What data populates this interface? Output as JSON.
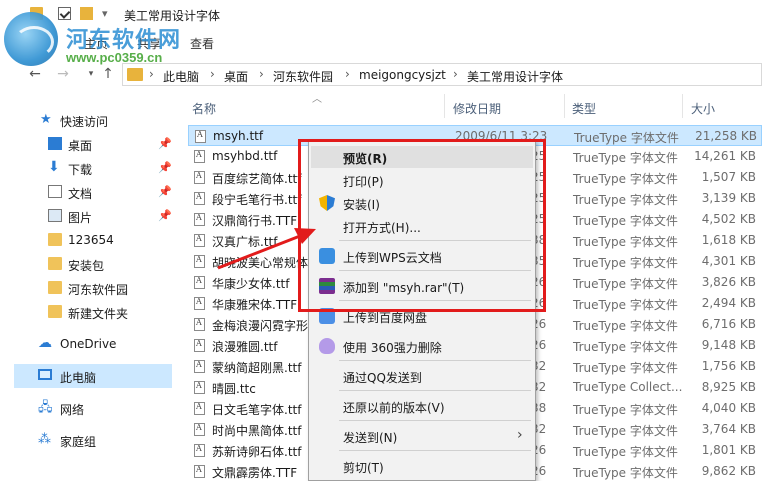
{
  "window": {
    "title": "美工常用设计字体"
  },
  "watermark": {
    "name": "河东软件网",
    "url": "www.pc0359.cn"
  },
  "ribbon": {
    "tabs": [
      "主页",
      "共享",
      "查看"
    ]
  },
  "address": {
    "crumbs": [
      "此电脑",
      "桌面",
      "河东软件园",
      "meigongcysjzt",
      "美工常用设计字体"
    ]
  },
  "navpane": {
    "items": [
      {
        "label": "快速访问",
        "icon": "star-icon",
        "pinned": false
      },
      {
        "label": "桌面",
        "icon": "desktop-icon",
        "pinned": true
      },
      {
        "label": "下载",
        "icon": "download-icon",
        "pinned": true
      },
      {
        "label": "文档",
        "icon": "document-icon",
        "pinned": true
      },
      {
        "label": "图片",
        "icon": "pictures-icon",
        "pinned": true
      },
      {
        "label": "123654",
        "icon": "folder-icon",
        "pinned": false
      },
      {
        "label": "安装包",
        "icon": "folder-icon",
        "pinned": false
      },
      {
        "label": "河东软件园",
        "icon": "folder-icon",
        "pinned": false
      },
      {
        "label": "新建文件夹",
        "icon": "folder-icon",
        "pinned": false
      },
      {
        "label": "OneDrive",
        "icon": "cloud-icon",
        "pinned": false
      },
      {
        "label": "此电脑",
        "icon": "pc-icon",
        "pinned": false
      },
      {
        "label": "网络",
        "icon": "network-icon",
        "pinned": false
      },
      {
        "label": "家庭组",
        "icon": "homegroup-icon",
        "pinned": false
      }
    ]
  },
  "filelist": {
    "columns": {
      "name": "名称",
      "date": "修改日期",
      "type": "类型",
      "size": "大小"
    },
    "rows": [
      {
        "name": "msyh.ttf",
        "date": "2009/6/11 3:23",
        "type": "TrueType 字体文件",
        "size": "21,258 KB"
      },
      {
        "name": "msyhbd.ttf",
        "date": "2009/6/11 3:25",
        "type": "TrueType 字体文件",
        "size": "14,261 KB"
      },
      {
        "name": "百度综艺简体.ttf",
        "date": "2017/1/5 11:25",
        "type": "TrueType 字体文件",
        "size": "1,507 KB"
      },
      {
        "name": "段宁毛笔行书.ttf",
        "date": "2017/1/5 11:25",
        "type": "TrueType 字体文件",
        "size": "3,139 KB"
      },
      {
        "name": "汉鼎简行书.TTF",
        "date": "2017/1/5 11:25",
        "type": "TrueType 字体文件",
        "size": "4,502 KB"
      },
      {
        "name": "汉真广标.ttf",
        "date": "2017/1/5 11:38",
        "type": "TrueType 字体文件",
        "size": "1,618 KB"
      },
      {
        "name": "胡晓波美心常规体.ttf",
        "date": "2017/1/5 11:35",
        "type": "TrueType 字体文件",
        "size": "4,301 KB"
      },
      {
        "name": "华康少女体.ttf",
        "date": "2017/1/5 11:26",
        "type": "TrueType 字体文件",
        "size": "3,826 KB"
      },
      {
        "name": "华康雅宋体.TTF",
        "date": "2017/1/5 11:26",
        "type": "TrueType 字体文件",
        "size": "2,494 KB"
      },
      {
        "name": "金梅浪漫闪霓字形.ttf",
        "date": "2017/1/5 11:26",
        "type": "TrueType 字体文件",
        "size": "6,716 KB"
      },
      {
        "name": "浪漫雅圆.ttf",
        "date": "2017/1/5 11:26",
        "type": "TrueType 字体文件",
        "size": "9,148 KB"
      },
      {
        "name": "蒙纳简超刚黑.ttf",
        "date": "2017/1/5 11:32",
        "type": "TrueType 字体文件",
        "size": "1,756 KB"
      },
      {
        "name": "晴圆.ttc",
        "date": "2017/1/5 11:32",
        "type": "TrueType Collect...",
        "size": "8,925 KB"
      },
      {
        "name": "日文毛笔字体.ttf",
        "date": "2017/1/5 11:38",
        "type": "TrueType 字体文件",
        "size": "4,040 KB"
      },
      {
        "name": "时尚中黑简体.ttf",
        "date": "2017/1/5 11:32",
        "type": "TrueType 字体文件",
        "size": "3,764 KB"
      },
      {
        "name": "苏新诗卵石体.ttf",
        "date": "2017/1/5 11:26",
        "type": "TrueType 字体文件",
        "size": "1,801 KB"
      },
      {
        "name": "文鼎霹雳体.TTF",
        "date": "2017/1/5 11:26",
        "type": "TrueType 字体文件",
        "size": "9,862 KB"
      }
    ]
  },
  "context_menu": {
    "items": [
      {
        "label": "预览(R)",
        "bold": true,
        "icon": ""
      },
      {
        "label": "打印(P)",
        "icon": ""
      },
      {
        "label": "安装(I)",
        "icon": "uac-shield-icon"
      },
      {
        "label": "打开方式(H)...",
        "icon": ""
      },
      {
        "label": "上传到WPS云文档",
        "icon": "wps-cloud-icon"
      },
      {
        "label": "添加到 \"msyh.rar\"(T)",
        "icon": "winrar-icon"
      },
      {
        "label": "上传到百度网盘",
        "icon": "baidu-netdisk-icon"
      },
      {
        "label": "使用 360强力删除",
        "icon": "360-delete-icon"
      },
      {
        "label": "通过QQ发送到",
        "icon": ""
      },
      {
        "label": "还原以前的版本(V)",
        "icon": ""
      },
      {
        "label": "发送到(N)",
        "icon": "",
        "submenu": true
      },
      {
        "label": "剪切(T)",
        "icon": ""
      }
    ]
  },
  "colors": {
    "selection": "#cce8ff",
    "annotation": "#e21b1b",
    "menu_bg": "#f2f2f2"
  }
}
